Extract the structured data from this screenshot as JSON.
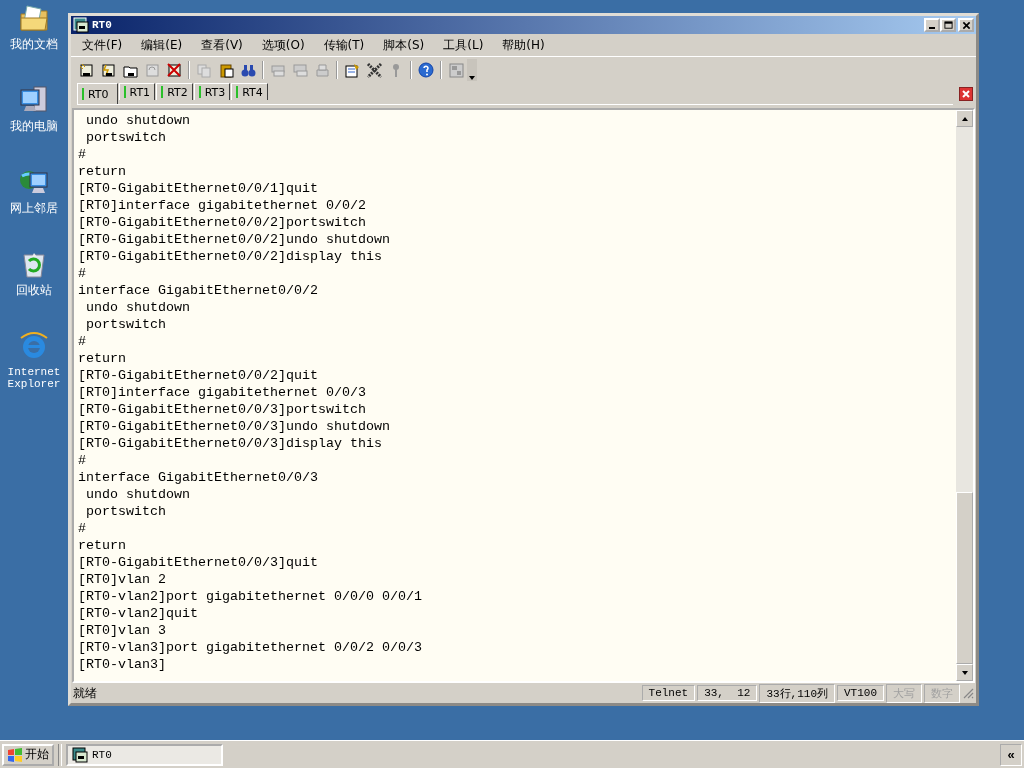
{
  "desktop_icons": [
    {
      "label": "我的文档",
      "kind": "documents"
    },
    {
      "label": "我的电脑",
      "kind": "computer"
    },
    {
      "label": "网上邻居",
      "kind": "network"
    },
    {
      "label": "回收站",
      "kind": "recycle"
    },
    {
      "label": "Internet Explorer",
      "kind": "browser"
    }
  ],
  "window": {
    "title": "RT0",
    "menu": [
      "文件(F)",
      "编辑(E)",
      "查看(V)",
      "选项(O)",
      "传输(T)",
      "脚本(S)",
      "工具(L)",
      "帮助(H)"
    ],
    "tabs": [
      {
        "label": "RT0",
        "selected": true
      },
      {
        "label": "RT1",
        "selected": false
      },
      {
        "label": "RT2",
        "selected": false
      },
      {
        "label": "RT3",
        "selected": false
      },
      {
        "label": "RT4",
        "selected": false
      }
    ],
    "terminal_lines": [
      " undo shutdown",
      " portswitch",
      "#",
      "return",
      "[RT0-GigabitEthernet0/0/1]quit",
      "[RT0]interface gigabitethernet 0/0/2",
      "[RT0-GigabitEthernet0/0/2]portswitch",
      "[RT0-GigabitEthernet0/0/2]undo shutdown",
      "[RT0-GigabitEthernet0/0/2]display this",
      "#",
      "interface GigabitEthernet0/0/2",
      " undo shutdown",
      " portswitch",
      "#",
      "return",
      "[RT0-GigabitEthernet0/0/2]quit",
      "[RT0]interface gigabitethernet 0/0/3",
      "[RT0-GigabitEthernet0/0/3]portswitch",
      "[RT0-GigabitEthernet0/0/3]undo shutdown",
      "[RT0-GigabitEthernet0/0/3]display this",
      "#",
      "interface GigabitEthernet0/0/3",
      " undo shutdown",
      " portswitch",
      "#",
      "return",
      "[RT0-GigabitEthernet0/0/3]quit",
      "[RT0]vlan 2",
      "[RT0-vlan2]port gigabitethernet 0/0/0 0/0/1",
      "[RT0-vlan2]quit",
      "[RT0]vlan 3",
      "[RT0-vlan3]port gigabitethernet 0/0/2 0/0/3",
      "[RT0-vlan3]"
    ],
    "status_bar": {
      "message": "就绪",
      "fields": [
        {
          "text": "Telnet",
          "disabled": false
        },
        {
          "text": "33,  12",
          "disabled": false
        },
        {
          "text": "33行,110列",
          "disabled": false
        },
        {
          "text": "VT100",
          "disabled": false
        },
        {
          "text": "大写",
          "disabled": true
        },
        {
          "text": "数字",
          "disabled": true
        }
      ]
    }
  },
  "taskbar": {
    "start": "开始",
    "tasks": [
      {
        "label": "RT0"
      }
    ],
    "tray_toggle": "«"
  }
}
